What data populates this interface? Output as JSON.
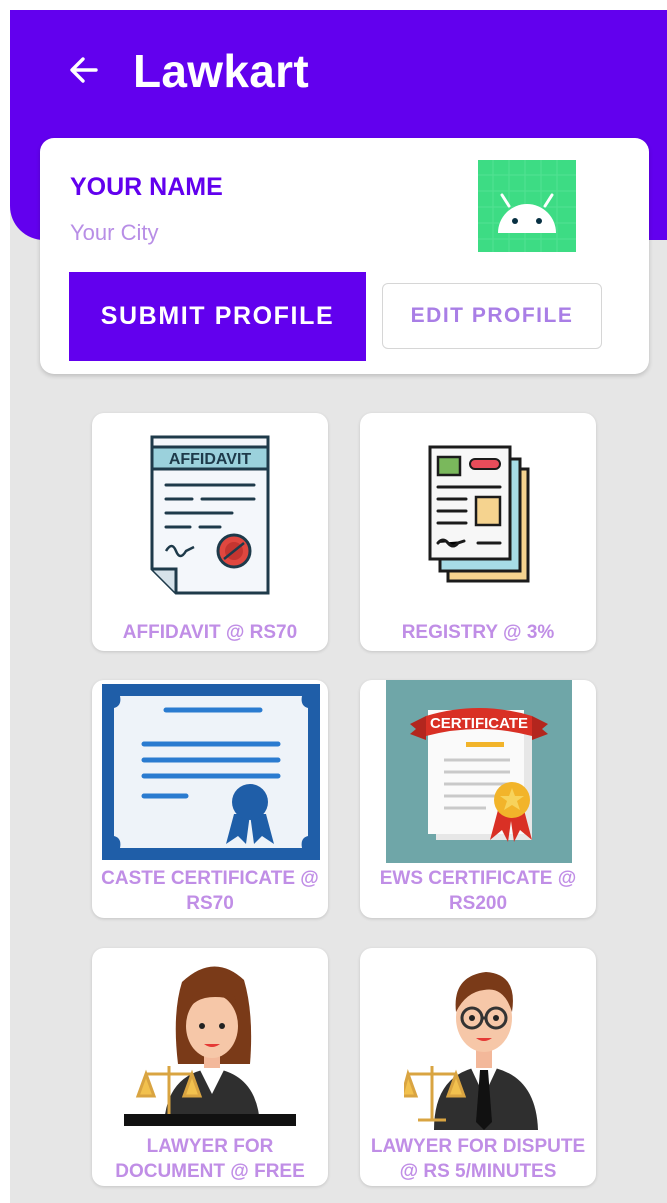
{
  "header": {
    "title": "Lawkart",
    "back_icon": "arrow-left-icon"
  },
  "profile": {
    "name": "YOUR NAME",
    "city": "Your City",
    "submit_label": "SUBMIT PROFILE",
    "edit_label": "EDIT PROFILE"
  },
  "services": [
    {
      "label": "AFFIDAVIT @ RS70",
      "icon": "affidavit-document-icon",
      "image_text": "AFFIDAVIT"
    },
    {
      "label": "REGISTRY @ 3%",
      "icon": "registry-documents-icon"
    },
    {
      "label": "CASTE CERTIFICATE @ RS70",
      "icon": "certificate-ribbon-icon"
    },
    {
      "label": "EWS CERTIFICATE @ RS200",
      "icon": "ews-certificate-icon",
      "image_text": "CERTIFICATE"
    },
    {
      "label": "LAWYER FOR DOCUMENT @ FREE",
      "icon": "female-lawyer-icon"
    },
    {
      "label": "LAWYER FOR DISPUTE @ RS 5/MINUTES",
      "icon": "male-lawyer-icon"
    }
  ],
  "colors": {
    "primary": "#6200ee",
    "accent_label": "#c08ee6",
    "background": "#e6e6e6"
  }
}
